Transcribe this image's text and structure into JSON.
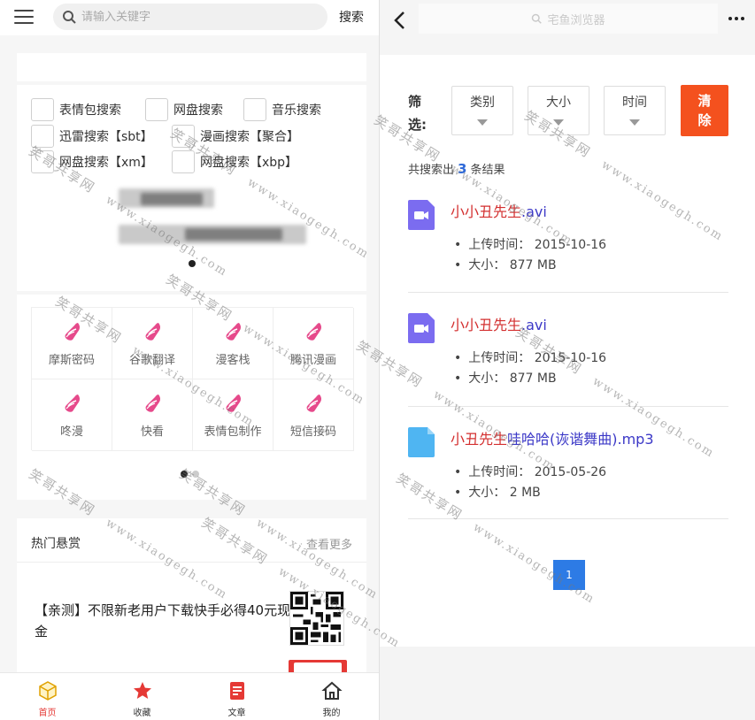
{
  "left": {
    "search": {
      "placeholder": "请输入关键字",
      "button": "搜索"
    },
    "engines": [
      {
        "label": "表情包搜索"
      },
      {
        "label": "网盘搜索"
      },
      {
        "label": "音乐搜索"
      },
      {
        "label": "迅雷搜索【sbt】"
      },
      {
        "label": "漫画搜索【聚合】"
      },
      {
        "label": "网盘搜索【xm】"
      },
      {
        "label": "网盘搜索【xbp】"
      }
    ],
    "tools": [
      {
        "label": "摩斯密码",
        "icon": "conch-icon"
      },
      {
        "label": "谷歌翻译",
        "icon": "conch-icon"
      },
      {
        "label": "漫客栈",
        "icon": "conch-icon"
      },
      {
        "label": "腾讯漫画",
        "icon": "conch-icon"
      },
      {
        "label": "咚漫",
        "icon": "conch-icon"
      },
      {
        "label": "快看",
        "icon": "conch-icon"
      },
      {
        "label": "表情包制作",
        "icon": "conch-icon"
      },
      {
        "label": "短信接码",
        "icon": "conch-icon"
      }
    ],
    "bounty": {
      "title": "热门悬赏",
      "more": "查看更多",
      "item_text": "【亲测】不限新老用户下载快手必得40元现金"
    },
    "tabbar": [
      {
        "label": "首页",
        "icon": "home-cube-icon",
        "active": true
      },
      {
        "label": "收藏",
        "icon": "star-icon",
        "active": false
      },
      {
        "label": "文章",
        "icon": "article-icon",
        "active": false
      },
      {
        "label": "我的",
        "icon": "house-icon",
        "active": false
      }
    ]
  },
  "right": {
    "addressbar": {
      "text": "宅鱼浏览器"
    },
    "filter": {
      "label_top": "筛",
      "label_bottom": "选:",
      "options": [
        {
          "label": "类别"
        },
        {
          "label": "大小"
        },
        {
          "label": "时间"
        }
      ],
      "clear_top": "清",
      "clear_bottom": "除"
    },
    "summary": {
      "prefix": "共搜索出",
      "count": "3",
      "suffix": "条结果"
    },
    "results": [
      {
        "title_hl": "小小丑先生",
        "title_rest": ".avi",
        "icon": "video-file-icon",
        "uploaded": "上传时间： 2015-10-16",
        "size": "大小： 877 MB"
      },
      {
        "title_hl": "小小丑先生",
        "title_rest": ".avi",
        "icon": "video-file-icon",
        "uploaded": "上传时间： 2015-10-16",
        "size": "大小： 877 MB"
      },
      {
        "title_hl": "小丑先生",
        "title_rest": "哇哈哈(诙谐舞曲).mp3",
        "icon": "file-icon",
        "uploaded": "上传时间： 2015-05-26",
        "size": "大小： 2 MB"
      }
    ],
    "pagination": {
      "current": "1"
    }
  },
  "watermark": {
    "cn": "笑哥共享网",
    "url": "www.xiaogegh.com"
  },
  "colors": {
    "accent_red": "#e53935",
    "clear_orange": "#f4511e",
    "link_purple": "#3b38c7",
    "page_blue": "#2d7be5",
    "file_purple": "#7b6cf0",
    "file_blue": "#4fb5f2"
  }
}
